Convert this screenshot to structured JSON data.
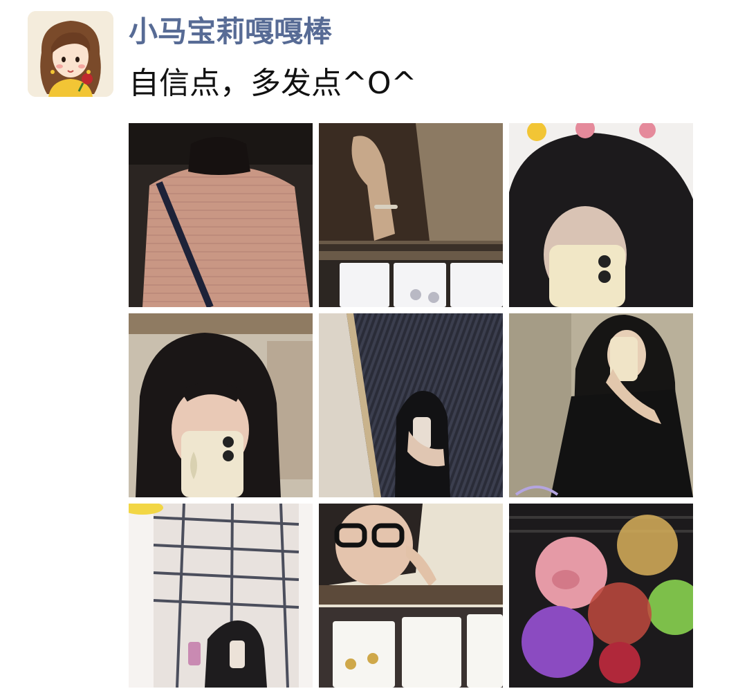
{
  "post": {
    "username": "小马宝莉嘎嘎棒",
    "text": "自信点，多发点^O^",
    "photos": [
      {
        "icon": "photo-pink-sweater-back"
      },
      {
        "icon": "photo-hand-with-earring-display"
      },
      {
        "icon": "photo-mirror-selfie-phone-cartoon-stickers"
      },
      {
        "icon": "photo-mirror-selfie-shop-shelves"
      },
      {
        "icon": "photo-escalator-mirror-selfie"
      },
      {
        "icon": "photo-black-shirt-mirror-selfie"
      },
      {
        "icon": "photo-ceiling-mirror-selfie"
      },
      {
        "icon": "photo-glasses-selfie-earrings"
      },
      {
        "icon": "photo-pig-balloons"
      }
    ]
  },
  "colors": {
    "username": "#576b95",
    "text": "#111111",
    "background": "#ffffff"
  }
}
